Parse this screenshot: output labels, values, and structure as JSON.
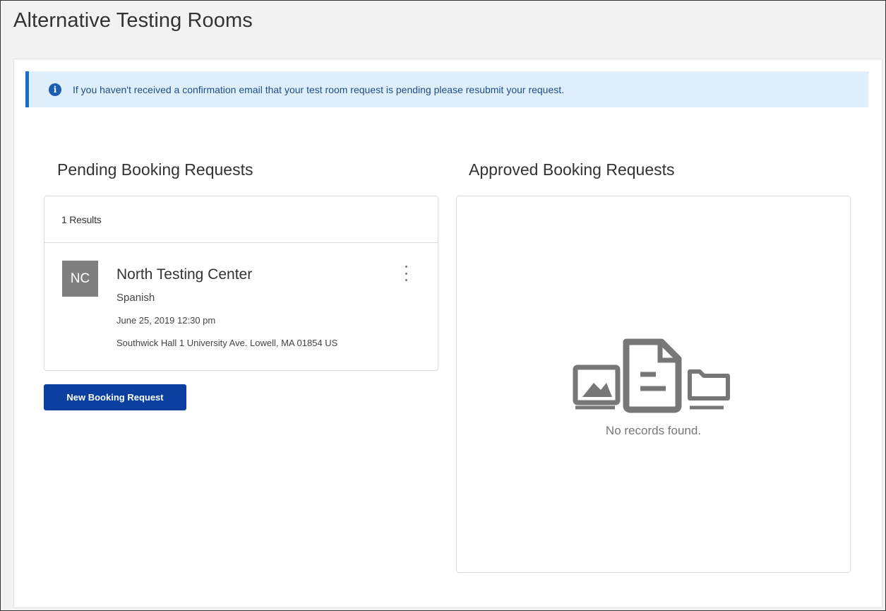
{
  "page": {
    "title": "Alternative Testing Rooms"
  },
  "alert": {
    "icon": "info-icon",
    "text": "If you haven't received a confirmation email that your test room request is pending please resubmit your request.",
    "accent_color": "#1a6ec5",
    "background_color": "#dfeefb"
  },
  "pending": {
    "title": "Pending Booking Requests",
    "results_label": "1 Results",
    "items": [
      {
        "initials": "NC",
        "name": "North Testing Center",
        "language": "Spanish",
        "datetime": "June 25, 2019 12:30 pm",
        "address": "Southwick Hall 1 University Ave. Lowell, MA 01854 US",
        "menu_icon": "more-vertical-icon"
      }
    ],
    "new_button_label": "New Booking Request",
    "button_color": "#0a3fa0"
  },
  "approved": {
    "title": "Approved Booking Requests",
    "empty_icon": "empty-records-icon",
    "empty_text": "No records found."
  }
}
